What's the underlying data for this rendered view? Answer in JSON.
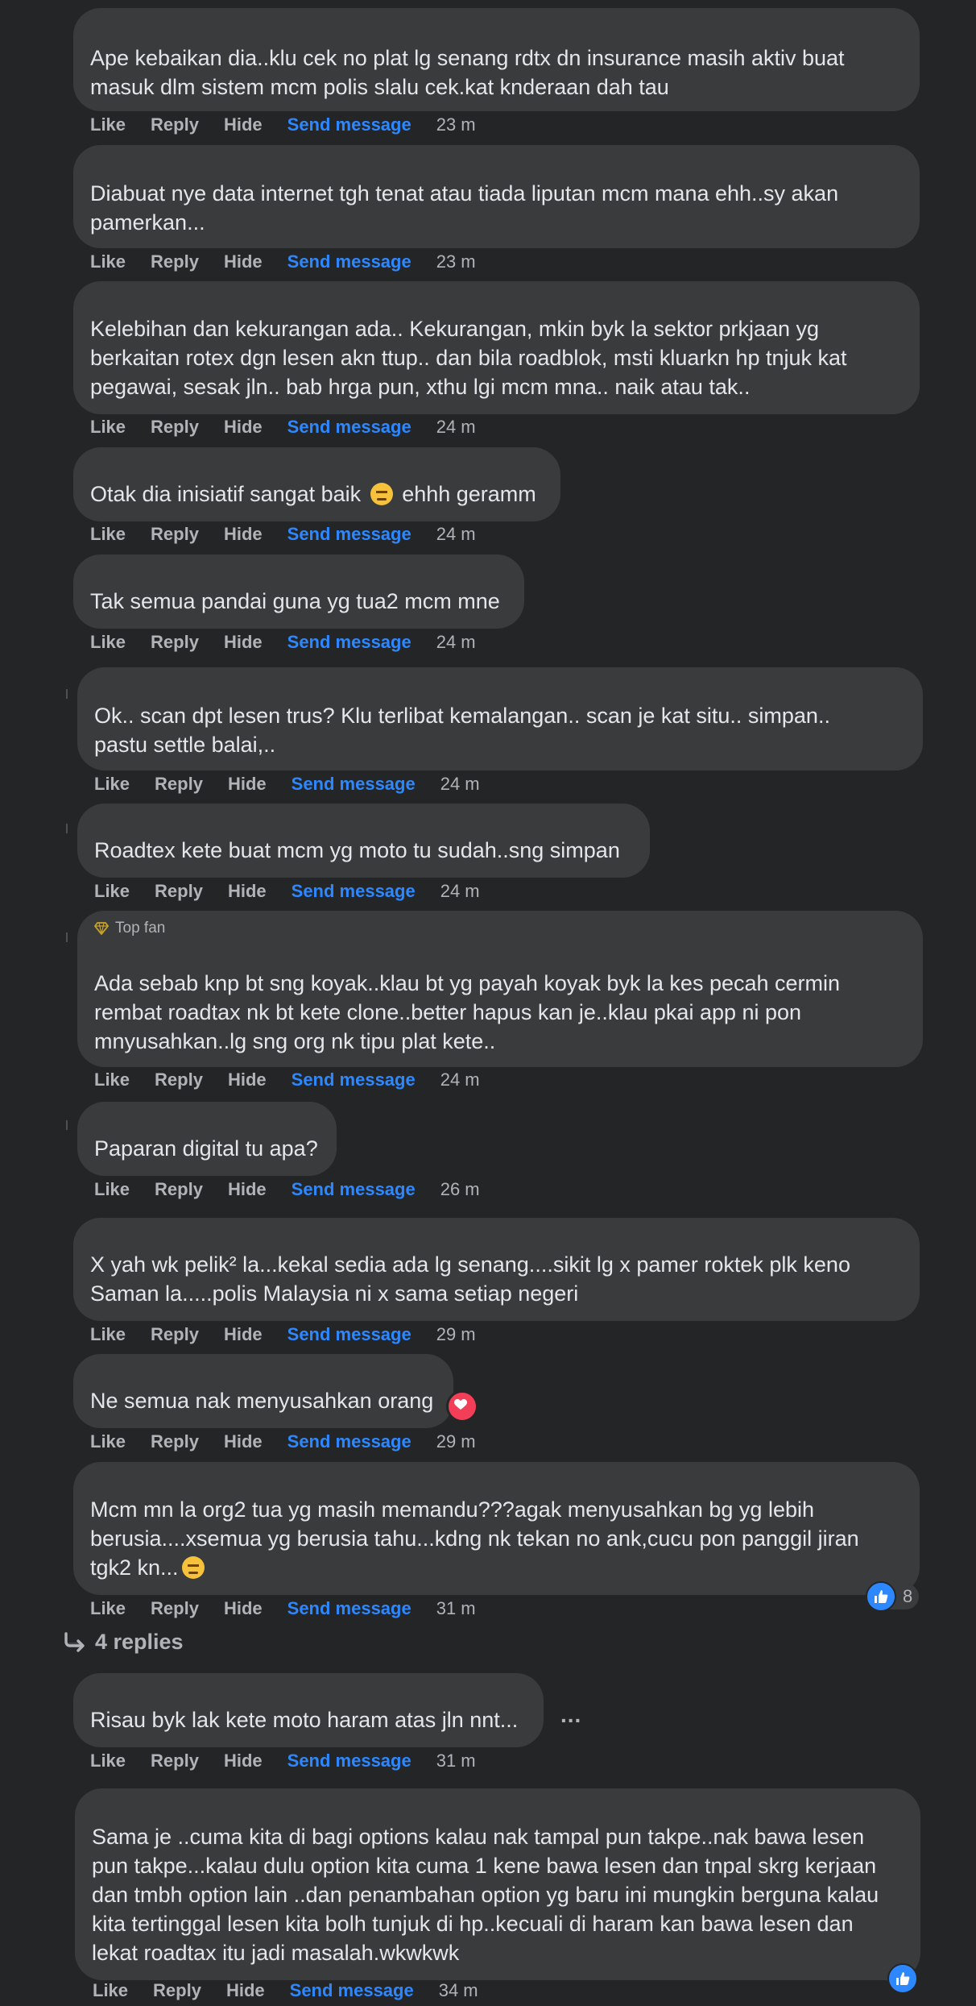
{
  "actions": {
    "like": "Like",
    "reply": "Reply",
    "hide": "Hide",
    "send_message": "Send message"
  },
  "comments": [
    {
      "text": "Ape kebaikan dia..klu cek no plat lg senang rdtx dn insurance masih aktiv buat\nmasuk dlm sistem mcm polis slalu cek.kat knderaan dah tau",
      "time": "23 m"
    },
    {
      "text": "Diabuat nye data internet tgh tenat atau tiada liputan mcm mana ehh..sy akan\npamerkan...",
      "time": "23 m"
    },
    {
      "text": "Kelebihan dan kekurangan ada.. Kekurangan, mkin byk la sektor prkjaan yg\nberkaitan rotex dgn lesen akn ttup.. dan bila roadblok, msti kluarkn hp tnjuk kat\npegawai, sesak jln.. bab hrga pun, xthu lgi mcm mna.. naik atau tak..",
      "time": "24 m"
    },
    {
      "text_before": "Otak dia inisiatif sangat baik ",
      "text_after": " ehhh geramm",
      "time": "24 m"
    },
    {
      "text": "Tak semua pandai guna yg tua2 mcm mne",
      "time": "24 m"
    },
    {
      "text": "Ok.. scan dpt lesen trus? Klu terlibat kemalangan.. scan je kat situ.. simpan..\npastu settle balai,..",
      "time": "24 m"
    },
    {
      "text": "Roadtex kete buat mcm yg moto tu sudah..sng simpan",
      "time": "24 m"
    },
    {
      "badge": "Top fan",
      "text": "Ada sebab knp bt sng koyak..klau bt yg payah koyak byk la kes pecah cermin\nrembat roadtax nk bt kete clone..better hapus kan je..klau pkai app ni pon\nmnyusahkan..lg sng org nk tipu plat kete..",
      "time": "24 m"
    },
    {
      "text": "Paparan digital tu apa?",
      "time": "26 m"
    },
    {
      "text": "X yah wk pelik² la...kekal sedia ada lg senang....sikit lg x pamer roktek plk keno\nSaman la.....polis Malaysia ni x sama setiap negeri",
      "time": "29 m"
    },
    {
      "text": "Ne semua nak menyusahkan orang",
      "time": "29 m"
    },
    {
      "text_before": "Mcm mn la org2 tua yg masih memandu???agak menyusahkan bg yg lebih\nberusia....xsemua yg berusia tahu...kdng nk tekan no ank,cucu pon panggil jiran\ntgk2 kn...",
      "text_after": "",
      "time": "31 m",
      "reaction_count": "8"
    },
    {
      "text": "Risau byk lak kete moto haram atas jln nnt...",
      "time": "31 m"
    },
    {
      "text": "Sama je ..cuma kita di bagi options kalau nak tampal pun takpe..nak bawa lesen\npun takpe...kalau dulu option kita cuma 1 kene bawa lesen dan tnpal skrg kerjaan\ndan tmbh option lain ..dan penambahan option yg baru ini mungkin berguna kalau\nkita tertinggal lesen kita bolh tunjuk di hp..kecuali di haram kan bawa lesen dan\nlekat roadtax itu jadi masalah.wkwkwk",
      "time": "34 m"
    }
  ],
  "replies_link": "4 replies",
  "more_options": "...",
  "icons": {
    "reaction_heart": "heart-icon",
    "reaction_like": "thumbs-up-icon",
    "top_fan": "diamond-icon",
    "replies": "reply-arrow-icon",
    "emoji": "unamused-face-icon"
  },
  "colors": {
    "background": "#242526",
    "bubble": "#3a3b3c",
    "link": "#2d88ff",
    "heart": "#f33e58"
  }
}
